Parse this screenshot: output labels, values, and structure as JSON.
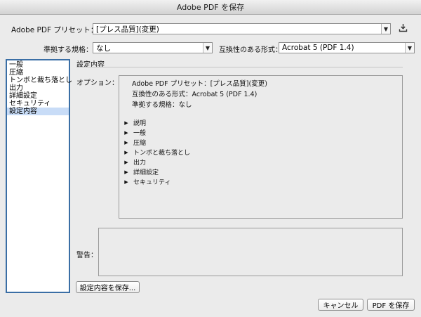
{
  "window": {
    "title": "Adobe PDF を保存"
  },
  "preset": {
    "label": "Adobe PDF プリセット：",
    "value": "[プレス品質](変更)"
  },
  "standard": {
    "label": "準拠する規格：",
    "value": "なし"
  },
  "compat": {
    "label": "互換性のある形式：",
    "value": "Acrobat 5 (PDF 1.4)"
  },
  "icons": {
    "save_preset": "save-preset-icon",
    "dropdown": "chevron-down-icon",
    "disclosure": "disclosure-triangle-icon"
  },
  "sidebar": {
    "items": [
      {
        "label": "一般",
        "selected": false
      },
      {
        "label": "圧縮",
        "selected": false
      },
      {
        "label": "トンボと裁ち落とし",
        "selected": false
      },
      {
        "label": "出力",
        "selected": false
      },
      {
        "label": "詳細設定",
        "selected": false
      },
      {
        "label": "セキュリティ",
        "selected": false
      },
      {
        "label": "設定内容",
        "selected": true
      }
    ]
  },
  "main": {
    "section_title": "設定内容",
    "options_label": "オプション：",
    "summary": [
      "Adobe PDF プリセット：[プレス品質](変更)",
      "互換性のある形式：Acrobat 5 (PDF 1.4)",
      "準拠する規格：なし"
    ],
    "tree": [
      "説明",
      "一般",
      "圧縮",
      "トンボと裁ち落とし",
      "出力",
      "詳細設定",
      "セキュリティ"
    ],
    "warning_label": "警告："
  },
  "buttons": {
    "save_summary": "設定内容を保存...",
    "cancel": "キャンセル",
    "save_pdf": "PDF を保存"
  },
  "colors": {
    "selection": "#c8dcf7",
    "focus_border": "#3a6ea5"
  }
}
